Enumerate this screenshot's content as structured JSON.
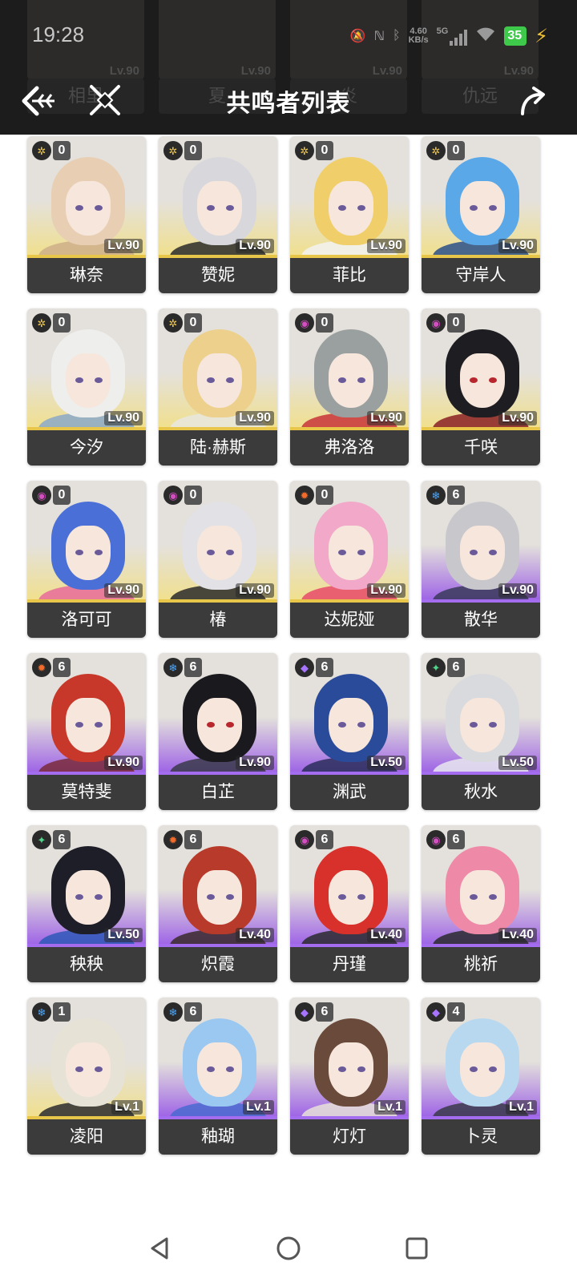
{
  "status_bar": {
    "time": "19:28",
    "net_speed_value": "4.60",
    "net_speed_unit": "KB/s",
    "network_type": "5G",
    "battery": "35"
  },
  "header": {
    "title": "共鸣者列表",
    "background_names": [
      "相里",
      "夏",
      "炎",
      "仇远"
    ],
    "background_levels": [
      "Lv.90",
      "Lv.90",
      "Lv.90",
      "Lv.90"
    ]
  },
  "colors": {
    "gold": "#e8c64a",
    "purple": "#a46df0",
    "name_bg": "#3b3b3b",
    "header_bg": "#1c1c1c",
    "spectro": "#f2c94c",
    "havoc": "#d14fbf",
    "fusion": "#f26b2a",
    "glacio": "#4aa8ff",
    "aero": "#4fd68a",
    "electro": "#a774ff"
  },
  "characters": [
    {
      "name": "琳奈",
      "level": "Lv.90",
      "seq": "0",
      "element": "spectro",
      "rarity": "gold",
      "hair": "#e8cfb4",
      "outfit": "#cfae8a"
    },
    {
      "name": "赞妮",
      "level": "Lv.90",
      "seq": "0",
      "element": "spectro",
      "rarity": "gold",
      "hair": "#d8d8dc",
      "outfit": "#2a2a2a"
    },
    {
      "name": "菲比",
      "level": "Lv.90",
      "seq": "0",
      "element": "spectro",
      "rarity": "gold",
      "hair": "#f0cf6a",
      "outfit": "#f2f2f2"
    },
    {
      "name": "守岸人",
      "level": "Lv.90",
      "seq": "0",
      "element": "spectro",
      "rarity": "gold",
      "hair": "#5aa8e8",
      "outfit": "#2a4f8a"
    },
    {
      "name": "今汐",
      "level": "Lv.90",
      "seq": "0",
      "element": "spectro",
      "rarity": "gold",
      "hair": "#eeeeec",
      "outfit": "#8aa8c8"
    },
    {
      "name": "陆·赫斯",
      "level": "Lv.90",
      "seq": "0",
      "element": "spectro",
      "rarity": "gold",
      "hair": "#ecd08c",
      "outfit": "#e8e6df"
    },
    {
      "name": "弗洛洛",
      "level": "Lv.90",
      "seq": "0",
      "element": "havoc",
      "rarity": "gold",
      "hair": "#9aa0a0",
      "outfit": "#c8323a"
    },
    {
      "name": "千咲",
      "level": "Lv.90",
      "seq": "0",
      "element": "havoc",
      "rarity": "gold",
      "hair": "#1e1e22",
      "outfit": "#8a1e24"
    },
    {
      "name": "洛可可",
      "level": "Lv.90",
      "seq": "0",
      "element": "havoc",
      "rarity": "gold",
      "hair": "#4a6fd6",
      "outfit": "#e86a9a"
    },
    {
      "name": "椿",
      "level": "Lv.90",
      "seq": "0",
      "element": "havoc",
      "rarity": "gold",
      "hair": "#e2e2e6",
      "outfit": "#2a2a2a"
    },
    {
      "name": "达妮娅",
      "level": "Lv.90",
      "seq": "0",
      "element": "fusion",
      "rarity": "gold",
      "hair": "#f2a8c8",
      "outfit": "#e84a6a"
    },
    {
      "name": "散华",
      "level": "Lv.90",
      "seq": "6",
      "element": "glacio",
      "rarity": "purple",
      "hair": "#c8c8cc",
      "outfit": "#3a3a5a"
    },
    {
      "name": "莫特斐",
      "level": "Lv.90",
      "seq": "6",
      "element": "fusion",
      "rarity": "purple",
      "hair": "#c8382a",
      "outfit": "#7a2a3a"
    },
    {
      "name": "白芷",
      "level": "Lv.90",
      "seq": "6",
      "element": "glacio",
      "rarity": "purple",
      "hair": "#1a1a1e",
      "outfit": "#3a3a4a"
    },
    {
      "name": "渊武",
      "level": "Lv.50",
      "seq": "6",
      "element": "electro",
      "rarity": "purple",
      "hair": "#2a4a9a",
      "outfit": "#2a2e5a"
    },
    {
      "name": "秋水",
      "level": "Lv.50",
      "seq": "6",
      "element": "aero",
      "rarity": "purple",
      "hair": "#d8dade",
      "outfit": "#e8e8ee"
    },
    {
      "name": "秧秧",
      "level": "Lv.50",
      "seq": "6",
      "element": "aero",
      "rarity": "purple",
      "hair": "#1e1e28",
      "outfit": "#2e58b8"
    },
    {
      "name": "炽霞",
      "level": "Lv.40",
      "seq": "6",
      "element": "fusion",
      "rarity": "purple",
      "hair": "#b83a2a",
      "outfit": "#3a2a2a"
    },
    {
      "name": "丹瑾",
      "level": "Lv.40",
      "seq": "6",
      "element": "havoc",
      "rarity": "purple",
      "hair": "#d8302a",
      "outfit": "#2a2a2e"
    },
    {
      "name": "桃祈",
      "level": "Lv.40",
      "seq": "6",
      "element": "havoc",
      "rarity": "purple",
      "hair": "#ee8aa8",
      "outfit": "#2a2a2e"
    },
    {
      "name": "凌阳",
      "level": "Lv.1",
      "seq": "1",
      "element": "glacio",
      "rarity": "gold",
      "hair": "#e6e2d6",
      "outfit": "#2a2a2e"
    },
    {
      "name": "釉瑚",
      "level": "Lv.1",
      "seq": "6",
      "element": "glacio",
      "rarity": "purple",
      "hair": "#9ac8f0",
      "outfit": "#4a6ad0"
    },
    {
      "name": "灯灯",
      "level": "Lv.1",
      "seq": "6",
      "element": "electro",
      "rarity": "purple",
      "hair": "#6a4a3a",
      "outfit": "#e8e0d8"
    },
    {
      "name": "卜灵",
      "level": "Lv.1",
      "seq": "4",
      "element": "electro",
      "rarity": "purple",
      "hair": "#b8d8f0",
      "outfit": "#3a3a4a"
    }
  ]
}
